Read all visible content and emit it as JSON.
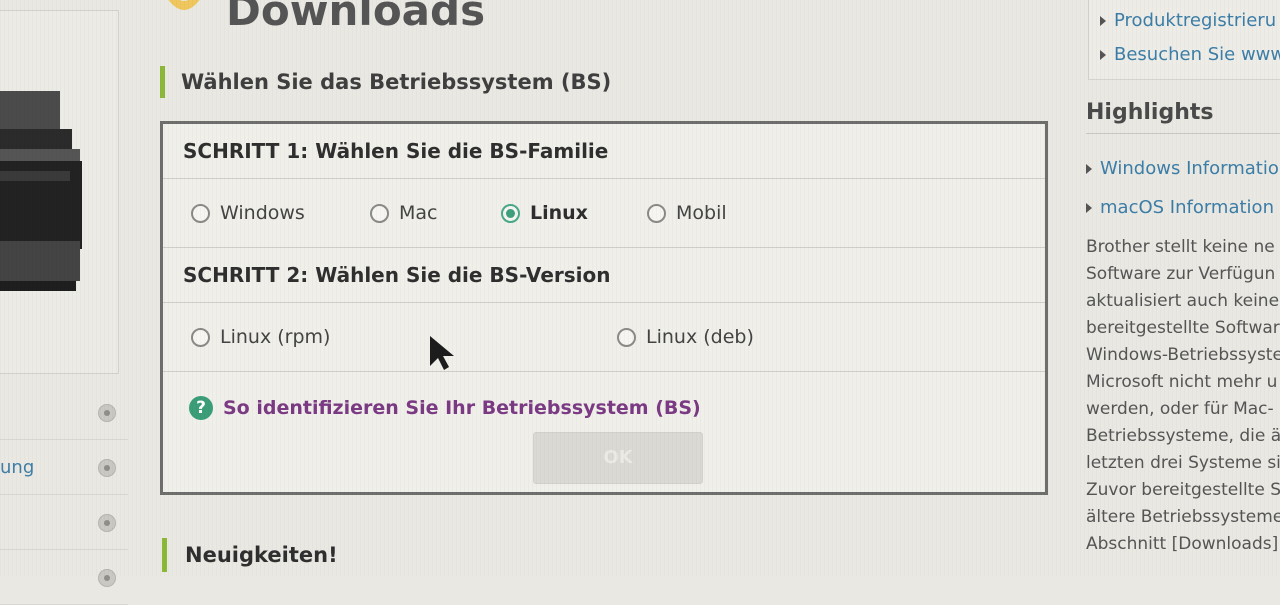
{
  "page": {
    "title": "Downloads"
  },
  "os_select": {
    "section_title": "Wählen Sie das Betriebssystem (BS)",
    "step1": {
      "title": "SCHRITT 1: Wählen Sie die BS-Familie",
      "options": [
        {
          "label": "Windows",
          "checked": false
        },
        {
          "label": "Mac",
          "checked": false
        },
        {
          "label": "Linux",
          "checked": true
        },
        {
          "label": "Mobil",
          "checked": false
        }
      ]
    },
    "step2": {
      "title": "SCHRITT 2: Wählen Sie die BS-Version",
      "options": [
        {
          "label": "Linux (rpm)",
          "checked": false
        },
        {
          "label": "Linux (deb)",
          "checked": false
        }
      ]
    },
    "help_link": "So identifizieren Sie Ihr Betriebssystem (BS)",
    "ok_button": "OK"
  },
  "news": {
    "title": "Neuigkeiten!"
  },
  "left_sidebar": {
    "items": [
      {
        "label": ""
      },
      {
        "label": "ung"
      },
      {
        "label": ""
      },
      {
        "label": ""
      }
    ]
  },
  "right_sidebar": {
    "links": [
      "Produktregistrieru",
      "Besuchen Sie www"
    ],
    "highlights_title": "Highlights",
    "highlights": [
      "Windows Informatio",
      "macOS Information"
    ],
    "text_lines": [
      "Brother stellt keine ne",
      "Software zur Verfügun",
      "aktualisiert auch keine",
      "bereitgestellte Softwar",
      "Windows-Betriebssyste",
      "Microsoft nicht mehr u",
      "werden, oder für Mac-",
      "Betriebssysteme, die ä",
      "letzten drei Systeme si",
      "Zuvor bereitgestellte S",
      "ältere Betriebssysteme",
      "Abschnitt [Downloads]"
    ]
  },
  "colors": {
    "accent_green": "#8cb83a",
    "link_blue": "#3c7ea7",
    "help_purple": "#7b3a84",
    "radio_green": "#3fa07d"
  }
}
